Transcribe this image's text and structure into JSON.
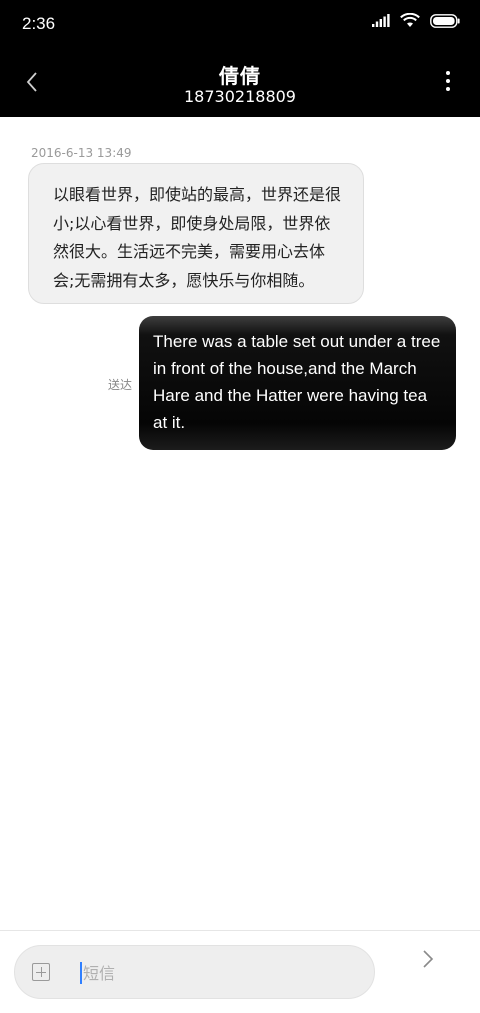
{
  "status_bar": {
    "time": "2:36",
    "icons": [
      "signal-icon",
      "wifi-icon",
      "battery-icon"
    ]
  },
  "header": {
    "contact_name": "倩倩",
    "contact_number": "18730218809",
    "icons": {
      "back": "chevron-left-icon",
      "more": "more-vertical-icon"
    }
  },
  "conversation": {
    "timestamp": "2016-6-13 13:49",
    "incoming_message": "以眼看世界，即使站的最高，世界还是很小;以心看世界，即使身处局限，世界依然很大。生活远不完美，需要用心去体会;无需拥有太多，愿快乐与你相随。",
    "outgoing_message": "There was a table set out under a tree in front of the house,and the March Hare and the Hatter were having tea at it.",
    "outgoing_status": "送达"
  },
  "composer": {
    "placeholder": "短信",
    "value": "",
    "icons": {
      "attach": "add-box-icon",
      "send": "send-chevron-icon"
    }
  },
  "colors": {
    "header_bg": "#000000",
    "incoming_bubble": "#f1f1f1",
    "outgoing_bubble": "#050505",
    "caret": "#2f7fff"
  }
}
